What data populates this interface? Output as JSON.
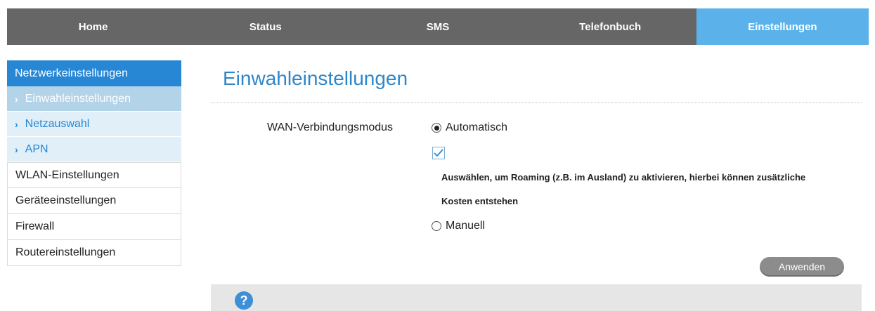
{
  "nav": {
    "tabs": [
      {
        "label": "Home"
      },
      {
        "label": "Status"
      },
      {
        "label": "SMS"
      },
      {
        "label": "Telefonbuch"
      },
      {
        "label": "Einstellungen"
      }
    ],
    "active_color": "#5bb2ea",
    "bar_color": "#666666"
  },
  "sidebar": {
    "group": "Netzwerkeinstellungen",
    "subitems": [
      {
        "label": "Einwahleinstellungen"
      },
      {
        "label": "Netzauswahl"
      },
      {
        "label": "APN"
      }
    ],
    "items": [
      {
        "label": "WLAN-Einstellungen"
      },
      {
        "label": "Geräteeinstellungen"
      },
      {
        "label": "Firewall"
      },
      {
        "label": "Routereinstellungen"
      }
    ]
  },
  "main": {
    "title": "Einwahleinstellungen",
    "field_label": "WAN-Verbindungsmodus",
    "option_auto": "Automatisch",
    "option_manual": "Manuell",
    "roaming_text": "Auswählen, um Roaming (z.B. im Ausland) zu aktivieren, hierbei können zusätzliche Kosten entstehen",
    "apply_label": "Anwenden",
    "help_glyph": "?"
  },
  "icons": {
    "arrow": "chevron-right-icon",
    "help": "help-icon"
  }
}
